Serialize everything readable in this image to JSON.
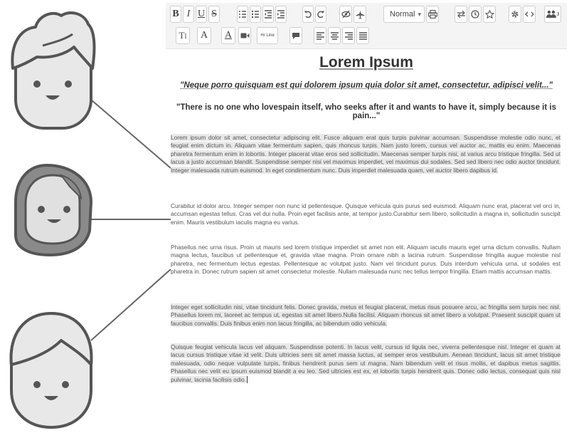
{
  "toolbar": {
    "row1": [
      {
        "name": "bold-button",
        "icon": "bold-icon",
        "glyph": "B"
      },
      {
        "name": "italic-button",
        "icon": "italic-icon",
        "glyph": "I"
      },
      {
        "name": "underline-button",
        "icon": "underline-icon",
        "glyph": "U"
      },
      {
        "name": "strikethrough-button",
        "icon": "strikethrough-icon",
        "glyph": "S"
      },
      {
        "name": "ordered-list-button",
        "icon": "ordered-list-icon"
      },
      {
        "name": "unordered-list-button",
        "icon": "unordered-list-icon"
      },
      {
        "name": "outdent-button",
        "icon": "outdent-icon"
      },
      {
        "name": "indent-button",
        "icon": "indent-icon"
      },
      {
        "name": "undo-button",
        "icon": "undo-icon"
      },
      {
        "name": "redo-button",
        "icon": "redo-icon"
      },
      {
        "name": "hide-button",
        "icon": "eye-slash-icon"
      },
      {
        "name": "send-button",
        "icon": "plane-icon"
      },
      {
        "name": "print-button",
        "icon": "printer-icon"
      },
      {
        "name": "swap-button",
        "icon": "swap-arrows-icon"
      },
      {
        "name": "history-button",
        "icon": "clock-icon"
      },
      {
        "name": "favorite-button",
        "icon": "star-icon"
      },
      {
        "name": "settings-button",
        "icon": "gear-icon"
      },
      {
        "name": "source-code-button",
        "icon": "code-icon"
      },
      {
        "name": "users-button",
        "icon": "users-icon",
        "badge": "3"
      }
    ],
    "style_select": {
      "value": "Normal"
    },
    "row2": [
      {
        "name": "text-size-button",
        "icon": "text-size-icon",
        "glyph": "T"
      },
      {
        "name": "font-button",
        "icon": "font-icon",
        "glyph": "A"
      },
      {
        "name": "font-color-button",
        "icon": "font-color-icon",
        "glyph": "A"
      },
      {
        "name": "video-button",
        "icon": "video-camera-icon"
      },
      {
        "name": "horizontal-line-button",
        "icon": "horizontal-line-icon",
        "label": "Hr Line"
      },
      {
        "name": "comment-button",
        "icon": "comment-icon"
      },
      {
        "name": "align-left-button",
        "icon": "align-left-icon"
      },
      {
        "name": "align-center-button",
        "icon": "align-center-icon"
      },
      {
        "name": "align-right-button",
        "icon": "align-right-icon"
      },
      {
        "name": "align-justify-button",
        "icon": "align-justify-icon"
      }
    ]
  },
  "document": {
    "title": "Lorem Ipsum",
    "quote1": "\"Neque porro quisquam est qui dolorem ipsum quia dolor sit amet, consectetur, adipisci velit...\"",
    "quote2": "\"There is no one who lovespain itself, who seeks after it and wants to have it, simply because it is pain...\"",
    "paragraphs": [
      "Lorem ipsum dolor sit amet, consectetur adipiscing elit. Fusce aliquam erat quis turpis pulvinar accumsan. Suspendisse molestie odio nunc, et feugiat enim dictum in. Aliquam vitae fermentum sapien, quis rhoncus turpis. Nam justo lorem, cursus vel auctor ac, mattis eu enim. Maecenas pharetra fermentum enim in lobortis. Integer placerat vitae eros sed sollicitudin. Maecenas semper turpis nisi, at varius arcu tristique fringilla. Sed ut lacus a justo accumsan blandit. Suspendisse semper nisi vel maximus imperdiet, vel maximus dui sodales. Sed sed libero nec odio auctor tincidunt. Integer malesuada rutrum euismod. In eget condimentum nunc. Duis imperdiet malesuada quam, vel auctor libero dapibus id.",
      "Curabitur id dolor arcu. Integer semper non nunc id pellentesque. Quisque vehicula quis purus sed euismod. Aliquam nunc erat, placerat vel orci in, accumsan egestas tellus. Cras vel dui nulla. Proin eget facilisis ante, at tempor justo.Curabitur sem libero, sollicitudin a magna in, sollicitudin suscipit enim. Mauris vestibulum iaculis magna eu varius.",
      "Phasellus nec urna risus. Proin ut mauris sed lorem tristique imperdiet sit amet non elit. Aliquam iaculis mauris eget urna dictum convallis. Nullam magna lectus, faucibus ut pellentesque et, gravida vitae magna. Proin ornare nibh a lacinia rutrum. Suspendisse fringilla augue molestie nisl pharetra, nec fermentum lectus egestas. Pellentesque ac volutpat justo. Nam vel tincidunt purus. Duis interdum vehicula urna, ut sodales est pharetra in. Donec rutrum sapien sit amet consectetur molestie. Nullam malesuada nunc nec tellus tempor fringilla. Etiam mattis accumsan mattis.",
      "Integer eget sollicitudin nisi, vitae tincidunt felis. Donec gravida, metus et feugiat placerat, metus risus posuere arcu, ac fringilla sem turpis nec nisl. Phasellus lorem mi, laoreet ac tempus ut, egestas sit amet libero.Nulla facilisi. Aliquam rhoncus sit amet libero a volutpat. Praesent suscipit quam ut faucibus convallis. Duis finibus enim non lacus fringilla, ac bibendum odio vehicula.",
      "Quisque feugiat vehicula lacus vel aliquam. Suspendisse potenti. In lacus velit, cursus id ligula nec, viverra pellentesque nisl. Integer et quam at lacus cursus tristique vitae id velit. Duis ultricies sem sit amet massa luctus, at semper eros vestibulum. Aenean tincidunt, lacus sit amet tristique malesuada, odio neque vulputate turpis, finibus hendrerit purus sem ut magna. Nam bibendum velit et risus mollis, et dapibus metus sagittis. Phasellus nec velit eu ipsum euismod blandit a eu leo. Sed ultricies est ex, et lobortis turpis hendrerit quis. Donec odio lectus, consequat quis nisl pulvinar, lacinia facilisis odio."
    ]
  },
  "avatars": [
    {
      "name": "collaborator-avatar-1",
      "icon": "man-avatar-icon"
    },
    {
      "name": "collaborator-avatar-2",
      "icon": "woman-hijab-avatar-icon"
    },
    {
      "name": "collaborator-avatar-3",
      "icon": "boy-avatar-icon"
    }
  ],
  "colors": {
    "avatar_fill": "#e8e8e8",
    "avatar_stroke": "#555555",
    "hijab_fill": "#8a8a8a",
    "connector": "#666666",
    "toolbar_bg": "#f4f4f4",
    "highlight": "#e9e9e9"
  }
}
